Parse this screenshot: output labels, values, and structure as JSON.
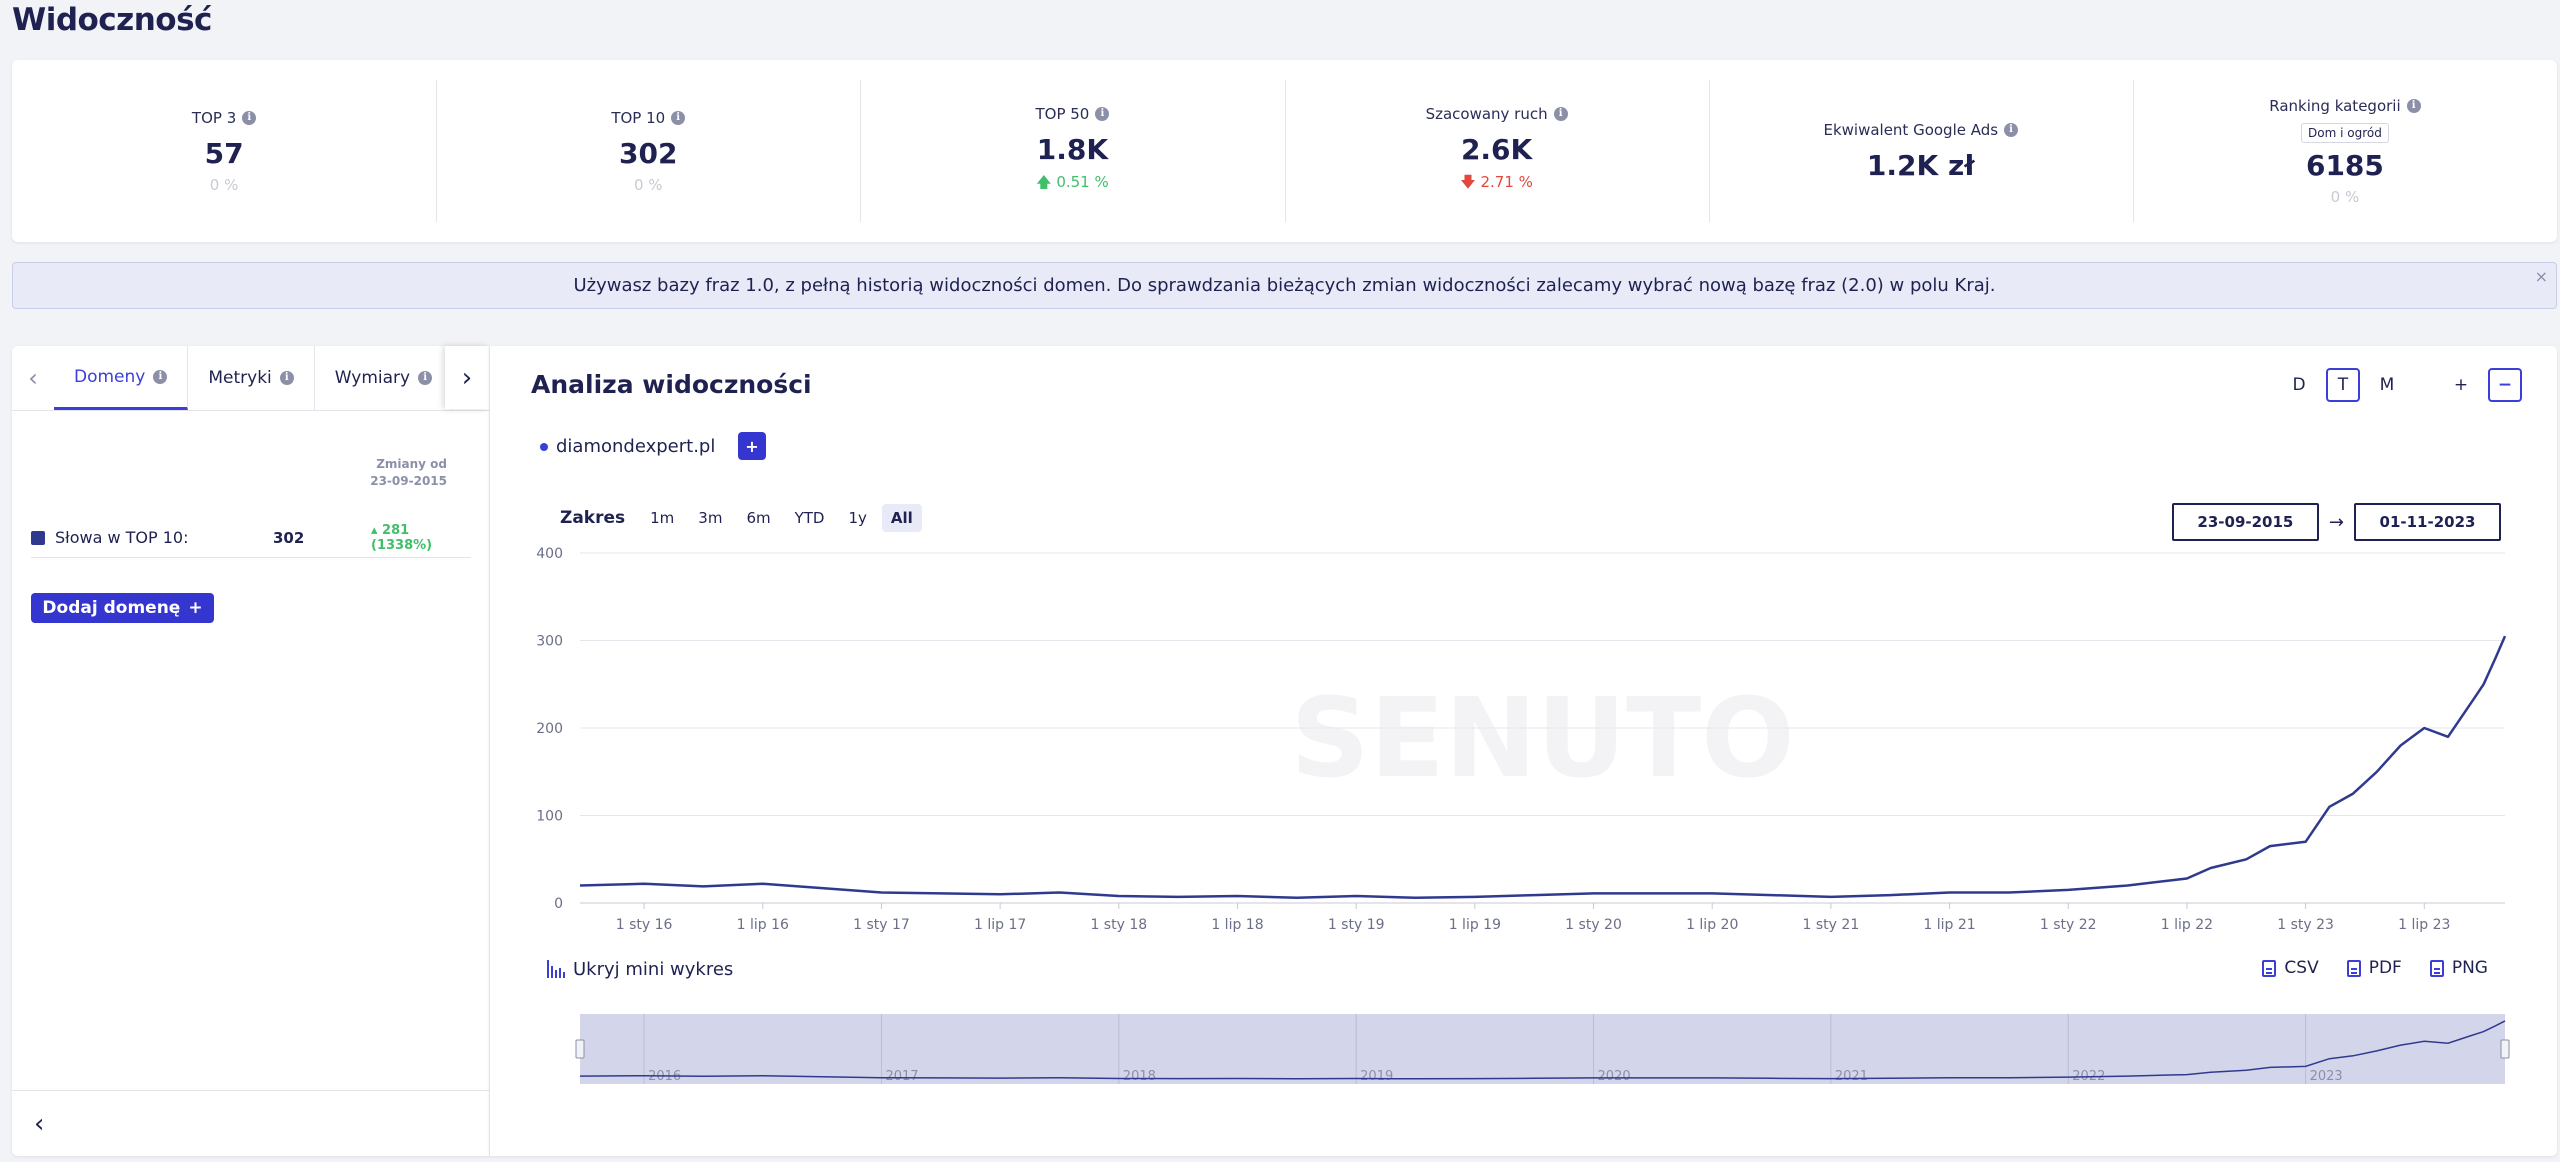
{
  "page_title": "Widoczność",
  "metrics": [
    {
      "label": "TOP 3",
      "value": "57",
      "change": "0 %",
      "trend": "neutral"
    },
    {
      "label": "TOP 10",
      "value": "302",
      "change": "0 %",
      "trend": "neutral"
    },
    {
      "label": "TOP 50",
      "value": "1.8K",
      "change": "0.51 %",
      "trend": "up"
    },
    {
      "label": "Szacowany ruch",
      "value": "2.6K",
      "change": "2.71 %",
      "trend": "down"
    },
    {
      "label": "Ekwiwalent Google Ads",
      "value": "1.2K zł"
    },
    {
      "label": "Ranking kategorii",
      "badge": "Dom i ogród",
      "value": "6185",
      "change": "0 %",
      "trend": "neutral"
    }
  ],
  "notice": {
    "text": "Używasz bazy fraz 1.0, z pełną historią widoczności domen. Do sprawdzania bieżących zmian widoczności zalecamy wybrać nową bazę fraz (2.0) w polu Kraj.",
    "close": "×"
  },
  "left_panel": {
    "tabs": [
      "Domeny",
      "Metryki",
      "Wymiary"
    ],
    "changes_header_line1": "Zmiany od",
    "changes_header_line2": "23-09-2015",
    "row": {
      "label": "Słowa w TOP 10:",
      "value": "302",
      "change": "▴ 281 (1338%)"
    },
    "add_domain": "Dodaj domenę",
    "add_plus": "+"
  },
  "right_panel": {
    "title": "Analiza widoczności",
    "period": [
      "D",
      "T",
      "M"
    ],
    "period_active": "T",
    "zoom_plus": "+",
    "zoom_minus": "−",
    "series_name": "diamondexpert.pl",
    "add_series": "+",
    "range_label": "Zakres",
    "ranges": [
      "1m",
      "3m",
      "6m",
      "YTD",
      "1y",
      "All"
    ],
    "range_active": "All",
    "date_from": "23-09-2015",
    "date_to": "01-11-2023",
    "date_arrow": "→",
    "mini_toggle": "Ukryj mini wykres",
    "exports": [
      "CSV",
      "PDF",
      "PNG"
    ],
    "watermark": "SENUTO"
  },
  "chart_data": {
    "type": "line",
    "series": [
      {
        "name": "diamondexpert.pl",
        "color": "#2f3a8f",
        "x": [
          2015.73,
          2016.0,
          2016.25,
          2016.5,
          2016.75,
          2017.0,
          2017.25,
          2017.5,
          2017.75,
          2018.0,
          2018.25,
          2018.5,
          2018.75,
          2019.0,
          2019.25,
          2019.5,
          2019.75,
          2020.0,
          2020.25,
          2020.5,
          2020.75,
          2021.0,
          2021.25,
          2021.5,
          2021.75,
          2022.0,
          2022.25,
          2022.5,
          2022.6,
          2022.75,
          2022.85,
          2023.0,
          2023.1,
          2023.2,
          2023.3,
          2023.4,
          2023.5,
          2023.6,
          2023.7,
          2023.75,
          2023.8,
          2023.84
        ],
        "y": [
          20,
          22,
          19,
          22,
          17,
          12,
          11,
          10,
          12,
          8,
          7,
          8,
          6,
          8,
          6,
          7,
          9,
          11,
          11,
          11,
          9,
          7,
          9,
          12,
          12,
          15,
          20,
          28,
          40,
          50,
          65,
          70,
          110,
          125,
          150,
          180,
          200,
          190,
          230,
          250,
          280,
          305
        ]
      }
    ],
    "x_ticks": [
      "1 sty 16",
      "1 lip 16",
      "1 sty 17",
      "1 lip 17",
      "1 sty 18",
      "1 lip 18",
      "1 sty 19",
      "1 lip 19",
      "1 sty 20",
      "1 lip 20",
      "1 sty 21",
      "1 lip 21",
      "1 sty 22",
      "1 lip 22",
      "1 sty 23",
      "1 lip 23"
    ],
    "y_ticks": [
      "400",
      "300",
      "200",
      "100",
      "0"
    ],
    "ylim": [
      0,
      400
    ],
    "navigator_years": [
      "2016",
      "2017",
      "2018",
      "2019",
      "2020",
      "2021",
      "2022",
      "2023"
    ],
    "grid": true
  }
}
